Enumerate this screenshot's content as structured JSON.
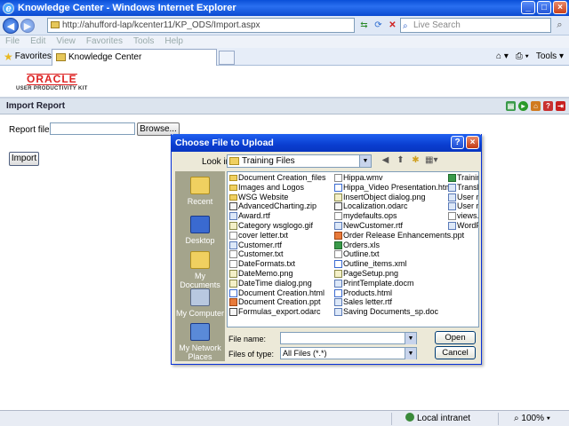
{
  "window": {
    "title": "Knowledge Center - Windows Internet Explorer"
  },
  "addressbar": {
    "url": "http://ahufford-lap/kcenter11/KP_ODS/Import.aspx",
    "search_placeholder": "Live Search"
  },
  "menu": [
    "File",
    "Edit",
    "View",
    "Favorites",
    "Tools",
    "Help"
  ],
  "favbar": {
    "favorites_label": "Favorites",
    "tab_title": "Knowledge Center",
    "tools_label": "Tools"
  },
  "logo": {
    "brand": "ORACLE",
    "subtitle": "USER PRODUCTIVITY KIT"
  },
  "page": {
    "header": "Import Report",
    "report_file_label": "Report file :",
    "browse_label": "Browse...",
    "import_label": "Import"
  },
  "dialog": {
    "title": "Choose File to Upload",
    "look_in_label": "Look in:",
    "look_in_value": "Training Files",
    "places": [
      "Recent",
      "Desktop",
      "My Documents",
      "My Computer",
      "My Network Places"
    ],
    "file_columns": [
      [
        {
          "name": "Document Creation_files",
          "type": "folder"
        },
        {
          "name": "Images and Logos",
          "type": "folder"
        },
        {
          "name": "WSG Website",
          "type": "folder"
        },
        {
          "name": "AdvancedCharting.zip",
          "type": "odarc"
        },
        {
          "name": "Award.rtf",
          "type": "doc"
        },
        {
          "name": "Category wsglogo.gif",
          "type": "img"
        },
        {
          "name": "cover letter.txt",
          "type": "txt"
        },
        {
          "name": "Customer.rtf",
          "type": "doc"
        },
        {
          "name": "Customer.txt",
          "type": "txt"
        },
        {
          "name": "DateFormats.txt",
          "type": "txt"
        },
        {
          "name": "DateMemo.png",
          "type": "img"
        },
        {
          "name": "DateTime dialog.png",
          "type": "img"
        },
        {
          "name": "Document Creation.html",
          "type": "html"
        },
        {
          "name": "Document Creation.ppt",
          "type": "ppt"
        },
        {
          "name": "Formulas_export.odarc",
          "type": "odarc"
        }
      ],
      [
        {
          "name": "Hippa.wmv",
          "type": "txt"
        },
        {
          "name": "Hippa_Video Presentation.html",
          "type": "html"
        },
        {
          "name": "InsertObject dialog.png",
          "type": "img"
        },
        {
          "name": "Localization.odarc",
          "type": "odarc"
        },
        {
          "name": "mydefaults.ops",
          "type": "txt"
        },
        {
          "name": "NewCustomer.rtf",
          "type": "doc"
        },
        {
          "name": "Order Release Enhancements.ppt",
          "type": "ppt"
        },
        {
          "name": "Orders.xls",
          "type": "excel"
        },
        {
          "name": "Outline.txt",
          "type": "txt"
        },
        {
          "name": "Outline_items.xml",
          "type": "html"
        },
        {
          "name": "PageSetup.png",
          "type": "img"
        },
        {
          "name": "PrintTemplate.docm",
          "type": "doc"
        },
        {
          "name": "Products.html",
          "type": "html"
        },
        {
          "name": "Sales letter.rtf",
          "type": "doc"
        },
        {
          "name": "Saving Documents_sp.doc",
          "type": "doc"
        }
      ],
      [
        {
          "name": "Training.x",
          "type": "excel"
        },
        {
          "name": "Translatior",
          "type": "doc"
        },
        {
          "name": "User repor",
          "type": "doc"
        },
        {
          "name": "User repor",
          "type": "doc"
        },
        {
          "name": "views.txt",
          "type": "txt"
        },
        {
          "name": "WordPad c",
          "type": "doc"
        }
      ]
    ],
    "file_name_label": "File name:",
    "file_name_value": "",
    "file_type_label": "Files of type:",
    "file_type_value": "All Files (*.*)",
    "open_label": "Open",
    "cancel_label": "Cancel"
  },
  "statusbar": {
    "zone": "Local intranet",
    "zoom": "100%"
  },
  "colors": {
    "title_blue": "#0a4fd8",
    "dialog_bg": "#ece9d8",
    "places_bg": "#a4a48c",
    "oracle_red": "#dd2222"
  }
}
